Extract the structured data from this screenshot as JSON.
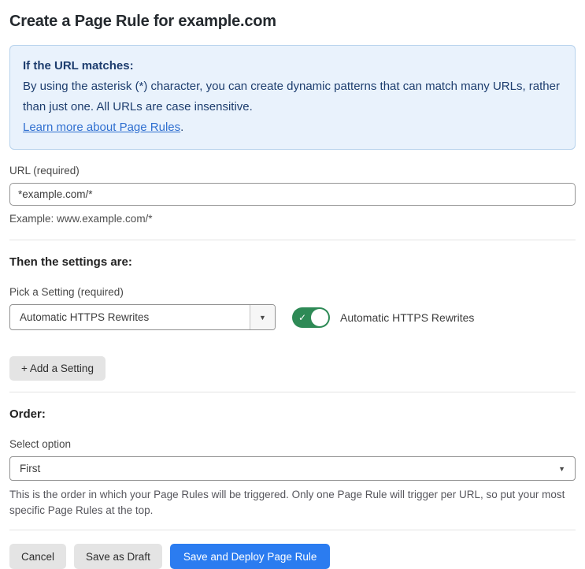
{
  "page": {
    "title": "Create a Page Rule for example.com"
  },
  "info_box": {
    "heading": "If the URL matches:",
    "body": "By using the asterisk (*) character, you can create dynamic patterns that can match many URLs, rather than just one. All URLs are case insensitive.",
    "link_label": "Learn more about Page Rules",
    "link_suffix": "."
  },
  "url_field": {
    "label": "URL (required)",
    "value": "*example.com/*",
    "hint": "Example: www.example.com/*"
  },
  "settings_section": {
    "heading": "Then the settings are:",
    "pick_label": "Pick a Setting (required)",
    "selected_setting": "Automatic HTTPS Rewrites",
    "toggle_state": "on",
    "toggle_label": "Automatic HTTPS Rewrites",
    "add_button_label": "+ Add a Setting"
  },
  "order_section": {
    "heading": "Order:",
    "select_label": "Select option",
    "selected_option": "First",
    "help": "This is the order in which your Page Rules will be triggered. Only one Page Rule will trigger per URL, so put your most specific Page Rules at the top."
  },
  "footer": {
    "cancel_label": "Cancel",
    "save_draft_label": "Save as Draft",
    "deploy_label": "Save and Deploy Page Rule"
  },
  "icons": {
    "dropdown_arrow": "▼",
    "toggle_check": "✓"
  },
  "colors": {
    "info_bg": "#e9f2fc",
    "info_border": "#b7d2ec",
    "info_text": "#1d3d6e",
    "link": "#2f6fd0",
    "toggle_on": "#2e8a56",
    "primary_button": "#2b7cf0",
    "gray_button": "#e4e4e4",
    "divider": "#e3e3e3"
  }
}
